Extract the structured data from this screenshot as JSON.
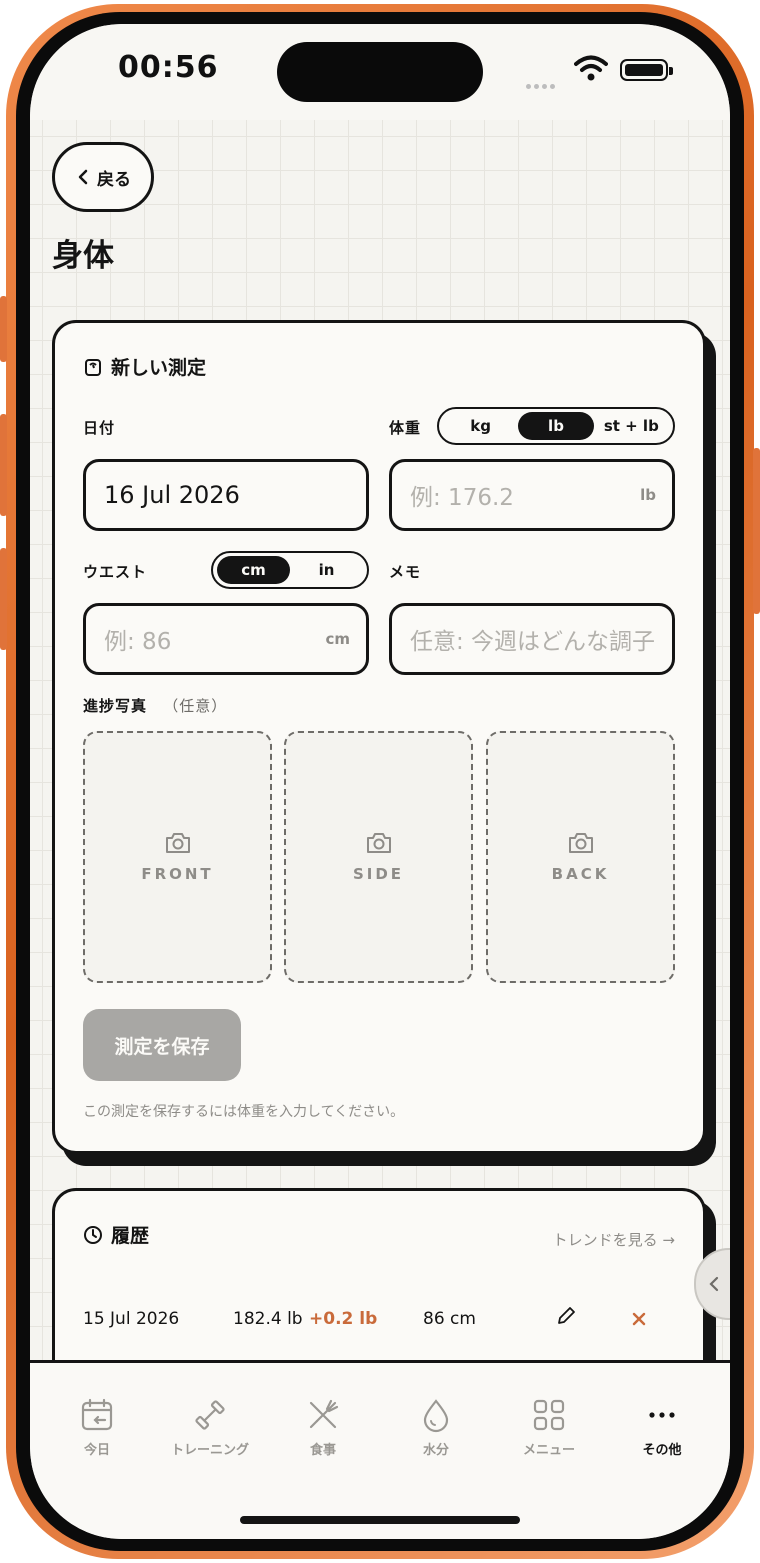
{
  "status_bar": {
    "time": "00:56"
  },
  "nav": {
    "back_label": "戻る",
    "title": "身体"
  },
  "new_measurement": {
    "header": "新しい測定",
    "date_label": "日付",
    "date_value": "16 Jul 2026",
    "weight_label": "体重",
    "weight_units": [
      "kg",
      "lb",
      "st + lb"
    ],
    "weight_unit_selected": "lb",
    "weight_placeholder": "例: 176.2",
    "weight_unit_suffix": "lb",
    "waist_label": "ウエスト",
    "waist_units": [
      "cm",
      "in"
    ],
    "waist_unit_selected": "cm",
    "waist_placeholder": "例: 86",
    "waist_unit_suffix": "cm",
    "memo_label": "メモ",
    "memo_placeholder": "任意: 今週はどんな調子",
    "photos_label": "進捗写真",
    "photos_optional": "（任意）",
    "photos": [
      "FRONT",
      "SIDE",
      "BACK"
    ],
    "save_button": "測定を保存",
    "save_hint": "この測定を保存するには体重を入力してください。"
  },
  "history": {
    "header": "履歴",
    "trend_link": "トレンドを見る →",
    "rows": [
      {
        "date": "15 Jul 2026",
        "weight": "182.4 lb",
        "delta": "+0.2 lb",
        "waist": "86 cm"
      }
    ]
  },
  "tabbar": {
    "items": [
      {
        "label": "今日",
        "icon": "calendar-icon"
      },
      {
        "label": "トレーニング",
        "icon": "dumbbell-icon"
      },
      {
        "label": "食事",
        "icon": "utensils-icon"
      },
      {
        "label": "水分",
        "icon": "drop-icon"
      },
      {
        "label": "メニュー",
        "icon": "grid-icon"
      },
      {
        "label": "その他",
        "icon": "more-icon"
      }
    ],
    "active": "その他"
  },
  "colors": {
    "ink": "#141414",
    "paper": "#fbfaf7",
    "accent": "#c96a3a",
    "frame": "#e0733a",
    "disabled": "#a8a7a4"
  }
}
